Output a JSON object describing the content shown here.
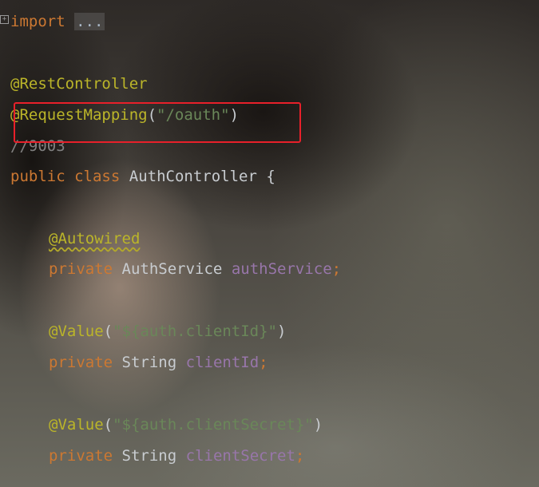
{
  "code": {
    "line1": {
      "keyword": "import",
      "folded": "..."
    },
    "line2": {
      "annotation": "@RestController"
    },
    "line3": {
      "annotation": "@RequestMapping",
      "open": "(",
      "string": "\"/oauth\"",
      "close": ")"
    },
    "line4": {
      "comment": "//9003"
    },
    "line5": {
      "kw1": "public",
      "kw2": "class",
      "name": "AuthController",
      "brace": "{"
    },
    "line6": {
      "annotation": "@Autowired"
    },
    "line7": {
      "kw": "private",
      "type": "AuthService",
      "field": "authService",
      "semi": ";"
    },
    "line8": {
      "annotation": "@Value",
      "open": "(",
      "string": "\"${auth.clientId}\"",
      "close": ")"
    },
    "line9": {
      "kw": "private",
      "type": "String",
      "field": "clientId",
      "semi": ";"
    },
    "line10": {
      "annotation": "@Value",
      "open": "(",
      "string": "\"${auth.clientSecret}\"",
      "close": ")"
    },
    "line11": {
      "kw": "private",
      "type": "String",
      "field": "clientSecret",
      "semi": ";"
    }
  },
  "icons": {
    "fold": "fold-plus-icon"
  },
  "colors": {
    "keyword": "#cc7832",
    "annotation": "#bbb529",
    "string": "#6a8759",
    "field": "#9876aa",
    "comment": "#808080",
    "highlight": "#e8202a"
  }
}
